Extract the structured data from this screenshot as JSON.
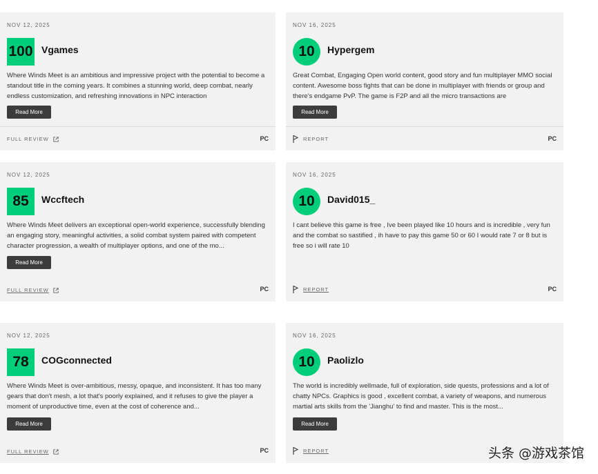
{
  "reviews": [
    {
      "date": "NOV 12, 2025",
      "score": "100",
      "outlet": "Vgames",
      "text": "Where Winds Meet is an ambitious and impressive project with the potential to become a standout title in the coming years. It combines a stunning world, deep combat, nearly endless customization, and refreshing innovations in NPC interaction",
      "button": "Read More",
      "footer": "FULL REVIEW",
      "platform": "PC"
    },
    {
      "date": "NOV 16, 2025",
      "score": "10",
      "outlet": "Hypergem",
      "text": "Great Combat, Engaging Open world content, good story and fun multiplayer MMO social content. Awesome boss fights that can be done in multiplayer with friends or group and there's endgame PvP. The game is F2P and all the micro transactions are",
      "button": "Read More",
      "footer": "REPORT",
      "platform": "PC"
    },
    {
      "date": "NOV 12, 2025",
      "score": "85",
      "outlet": "Wccftech",
      "text": "Where Winds Meet delivers an exceptional open-world experience, successfully blending an engaging story, meaningful activities, a solid combat system paired with competent character progression, a wealth of multiplayer options, and one of the mo...",
      "button": "Read More",
      "footer": "FULL REVIEW",
      "platform": "PC"
    },
    {
      "date": "NOV 16, 2025",
      "score": "10",
      "outlet": "David015_",
      "text": "I cant believe this game is free , Ive been played like 10 hours and is incredible , very fun and the combat so sastified , ih have to pay this game 50 or 60 I would rate 7 or 8 but is free so i will rate 10",
      "button": "",
      "footer": "REPORT",
      "platform": "PC"
    },
    {
      "date": "NOV 12, 2025",
      "score": "78",
      "outlet": "COGconnected",
      "text": "Where Winds Meet is over-ambitious, messy, opaque, and inconsistent. It has too many gears that don't mesh, a lot that's poorly explained, and it refuses to give the player a moment of unproductive time, even at the cost of coherence and...",
      "button": "Read More",
      "footer": "FULL REVIEW",
      "platform": "PC"
    },
    {
      "date": "NOV 16, 2025",
      "score": "10",
      "outlet": "Paolizlo",
      "text": "The world is incredibly wellmade, full of exploration, side quests, professions and a lot of chatty NPCs. Graphics is good , excellent combat, a variety of weapons, and numerous martial arts skills from the 'Jianghu' to find and master. This is the most...",
      "button": "Read More",
      "footer": "REPORT",
      "platform": "PC"
    }
  ],
  "watermark": "头条 @游戏茶馆",
  "colors": {
    "score_bg": "#00ce7a",
    "card_bg": "#f2f2f2",
    "button_bg": "#3c3c3c"
  }
}
